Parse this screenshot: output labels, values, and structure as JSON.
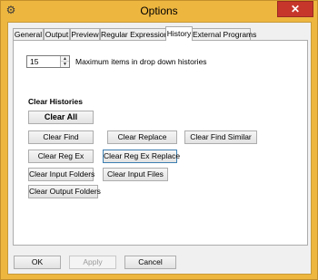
{
  "window": {
    "title": "Options",
    "close_label": "✕"
  },
  "tabs": [
    {
      "label": "General",
      "active": false
    },
    {
      "label": "Output",
      "active": false
    },
    {
      "label": "Preview",
      "active": false
    },
    {
      "label": "Regular Expressions",
      "active": false
    },
    {
      "label": "History",
      "active": true
    },
    {
      "label": "External Programs",
      "active": false
    }
  ],
  "history": {
    "max_items_value": "15",
    "max_items_label": "Maximum items in drop down histories",
    "section_title": "Clear Histories",
    "buttons": {
      "clear_all": "Clear All",
      "clear_find": "Clear Find",
      "clear_replace": "Clear Replace",
      "clear_find_similar": "Clear Find Similar",
      "clear_reg_ex": "Clear Reg Ex",
      "clear_reg_ex_replace": "Clear Reg Ex Replace",
      "clear_input_folders": "Clear Input Folders",
      "clear_input_files": "Clear Input Files",
      "clear_output_folders": "Clear Output Folders"
    }
  },
  "footer": {
    "ok": "OK",
    "apply": "Apply",
    "cancel": "Cancel"
  },
  "colors": {
    "title_bar": "#edb63f",
    "close_button": "#c7362b",
    "panel": "#ffffff",
    "dialog": "#f0f0f0"
  }
}
